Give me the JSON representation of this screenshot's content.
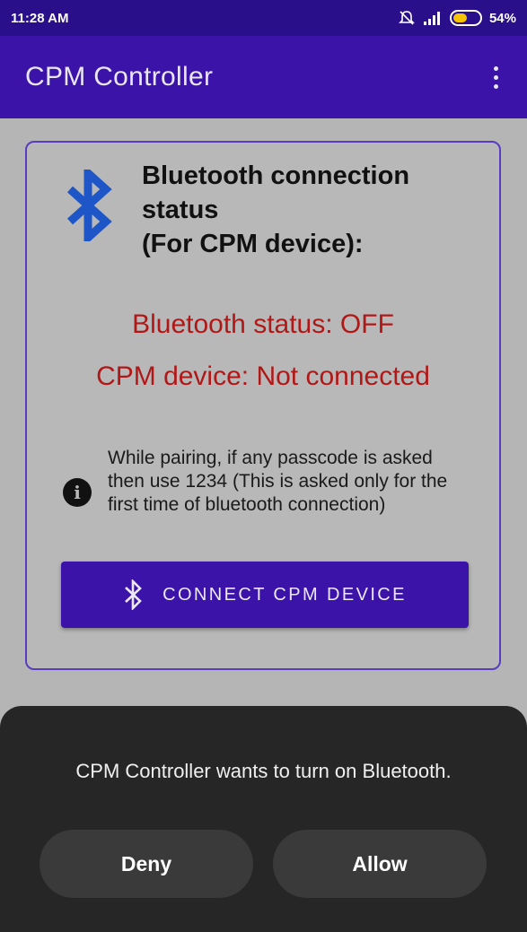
{
  "status_bar": {
    "time": "11:28 AM",
    "network": ".ıl",
    "battery": "54%",
    "battery_level": 0.54
  },
  "app_bar": {
    "title": "CPM Controller",
    "menu_icon": "overflow-menu-icon"
  },
  "card": {
    "icon": "bluetooth-icon",
    "heading_line1": "Bluetooth connection",
    "heading_line2": "status",
    "heading_line3": "(For CPM device):",
    "bluetooth_status": "Bluetooth status: OFF",
    "device_status": "CPM device: Not connected",
    "info_icon": "info-icon",
    "info_text": "While pairing, if any passcode is asked then use 1234 (This is asked only for the first time of bluetooth connection)",
    "connect_button_label": "CONNECT CPM DEVICE"
  },
  "dialog": {
    "message": "CPM Controller wants to turn on Bluetooth.",
    "deny_label": "Deny",
    "allow_label": "Allow"
  },
  "colors": {
    "primary": "#3c13a8",
    "status_bar": "#2a0f8a",
    "error_text": "#b01818",
    "bluetooth_blue": "#1f56c7",
    "dialog_bg": "#262626"
  }
}
